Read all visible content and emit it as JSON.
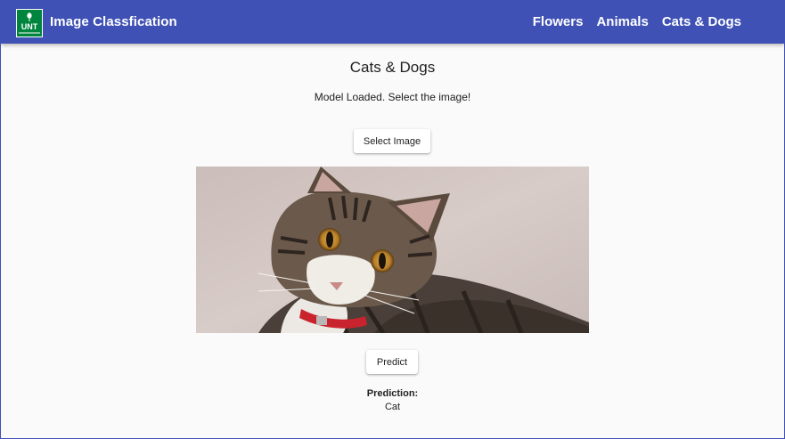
{
  "navbar": {
    "logo_text": "UNT",
    "brand": "Image Classfication",
    "links": [
      {
        "label": "Flowers"
      },
      {
        "label": "Animals"
      },
      {
        "label": "Cats & Dogs"
      }
    ],
    "bg_color": "#3f51b5"
  },
  "main": {
    "title": "Cats & Dogs",
    "status": "Model Loaded. Select the image!",
    "select_button": "Select Image",
    "predict_button": "Predict",
    "prediction_label": "Prediction:",
    "prediction_value": "Cat"
  },
  "preview": {
    "subject": "tabby-cat-photo"
  }
}
